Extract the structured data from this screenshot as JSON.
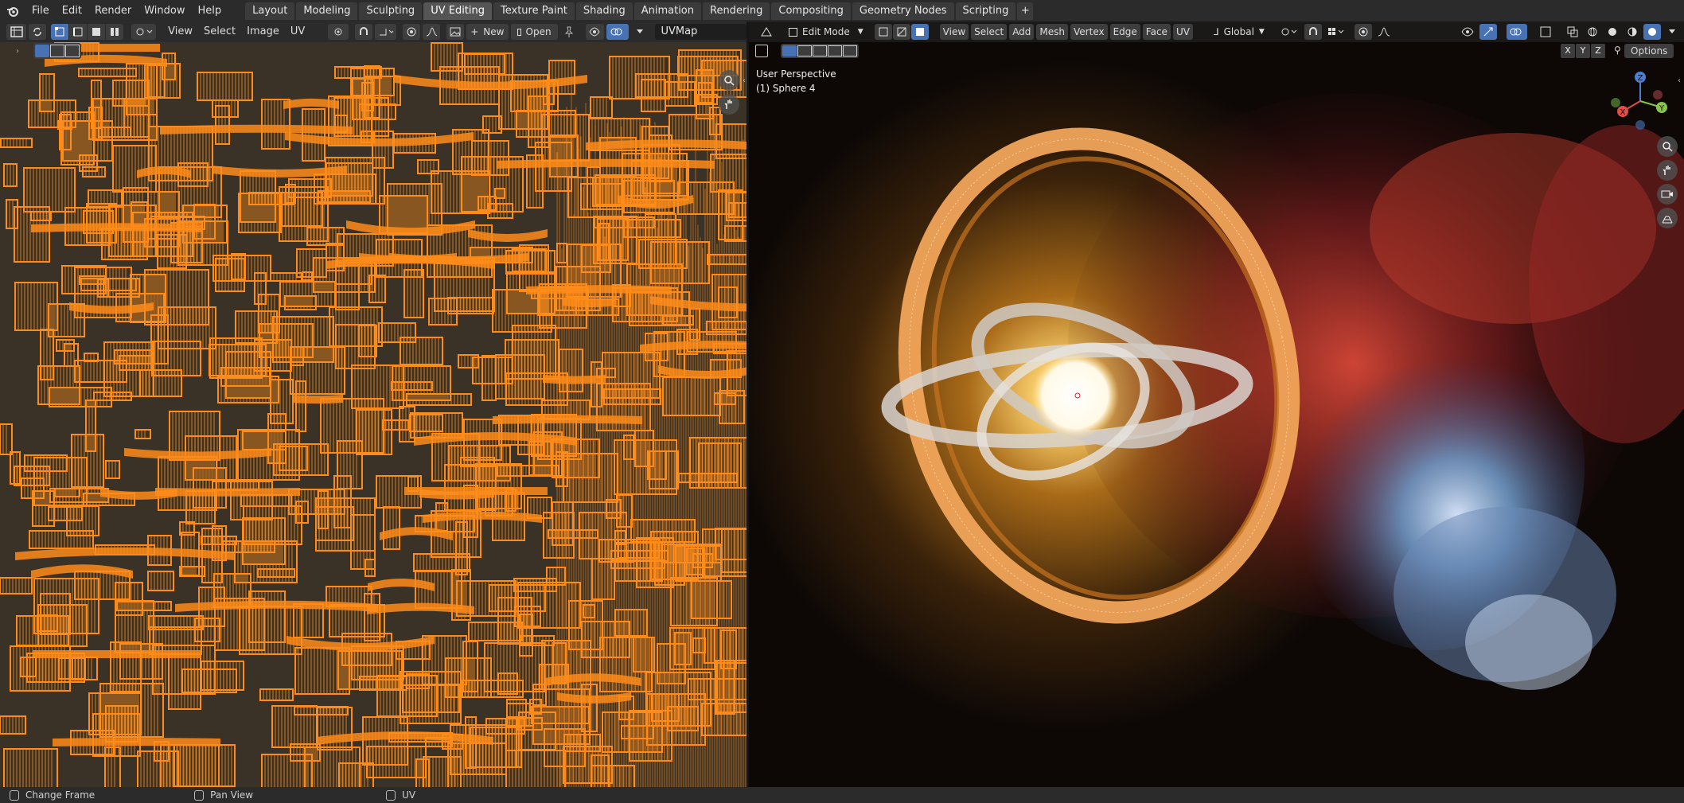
{
  "topbar": {
    "menus": [
      "File",
      "Edit",
      "Render",
      "Window",
      "Help"
    ],
    "workspaces": [
      "Layout",
      "Modeling",
      "Sculpting",
      "UV Editing",
      "Texture Paint",
      "Shading",
      "Animation",
      "Rendering",
      "Compositing",
      "Geometry Nodes",
      "Scripting"
    ],
    "active_workspace": "UV Editing",
    "add_tab": "+"
  },
  "uv_editor": {
    "menus": [
      "View",
      "Select",
      "Image",
      "UV"
    ],
    "new_label": "New",
    "open_label": "Open",
    "uvmap_field": "UVMap",
    "uv_color": "#ff8c1a"
  },
  "viewport": {
    "mode": "Edit Mode",
    "menus": [
      "View",
      "Select",
      "Add",
      "Mesh",
      "Vertex",
      "Edge",
      "Face",
      "UV"
    ],
    "orientation": "Global",
    "perspective_label": "User Perspective",
    "object_label": "(1) Sphere 4",
    "axes": [
      "X",
      "Y",
      "Z"
    ],
    "options_label": "Options",
    "gizmo_labels": {
      "x": "X",
      "y": "Y",
      "z": "Z"
    }
  },
  "statusbar": {
    "items": [
      "Change Frame",
      "Pan View",
      "UV"
    ]
  }
}
